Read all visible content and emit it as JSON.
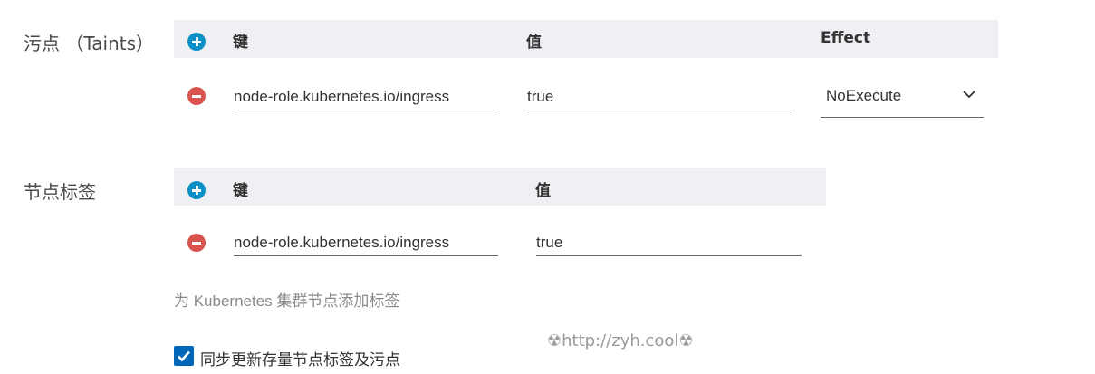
{
  "taints": {
    "label": "污点 （Taints）",
    "headers": {
      "key": "键",
      "value": "值",
      "effect": "Effect"
    },
    "row": {
      "key": "node-role.kubernetes.io/ingress",
      "value": "true",
      "effect": "NoExecute"
    }
  },
  "labels": {
    "label": "节点标签",
    "headers": {
      "key": "键",
      "value": "值"
    },
    "row": {
      "key": "node-role.kubernetes.io/ingress",
      "value": "true"
    },
    "helper": "为 Kubernetes 集群节点添加标签"
  },
  "sync": {
    "checked": true,
    "label": "同步更新存量节点标签及污点"
  },
  "watermark": "☢http://zyh.cool☢",
  "colors": {
    "add": "#0a8fc7",
    "remove": "#d9534f",
    "header_bg": "#eff0f4",
    "checkbox": "#0067b8"
  },
  "icons": {
    "add": "plus-circle-icon",
    "remove": "minus-circle-icon",
    "chevron": "chevron-down-icon",
    "check": "checkmark-icon"
  }
}
